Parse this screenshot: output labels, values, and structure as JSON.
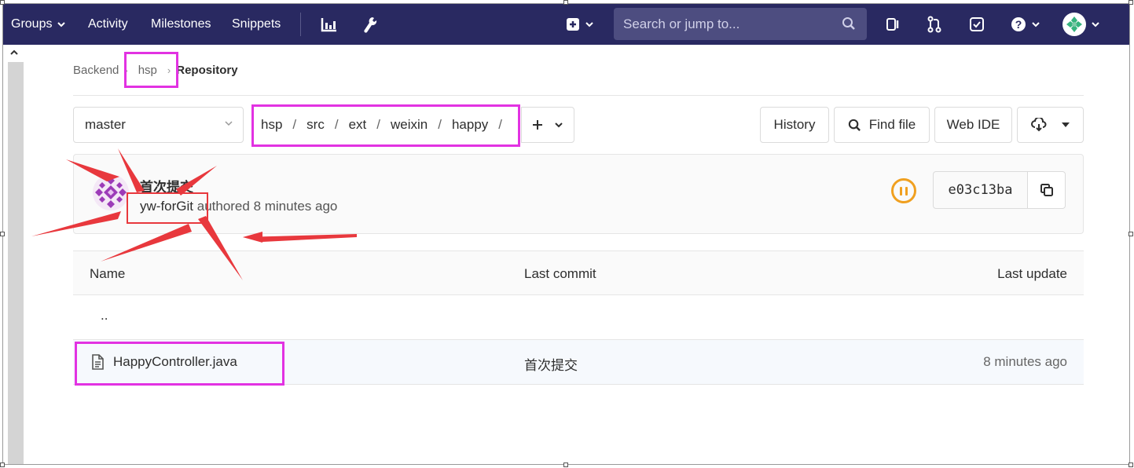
{
  "navbar": {
    "groups": "Groups",
    "activity": "Activity",
    "milestones": "Milestones",
    "snippets": "Snippets",
    "search_placeholder": "Search or jump to..."
  },
  "breadcrumb": {
    "parent": "Backend",
    "project": "hsp",
    "current": "Repository"
  },
  "toolbar": {
    "branch": "master",
    "path_segments": [
      "hsp",
      "src",
      "ext",
      "weixin",
      "happy"
    ],
    "history": "History",
    "find_file": "Find file",
    "web_ide": "Web IDE"
  },
  "commit": {
    "title": "首次提交",
    "author": "yw-forGit",
    "meta": "authored 8 minutes ago",
    "sha": "e03c13ba",
    "pipeline_status": "paused"
  },
  "files": {
    "headers": {
      "name": "Name",
      "last_commit": "Last commit",
      "last_update": "Last update"
    },
    "parent_dir": "..",
    "rows": [
      {
        "name": "HappyController.java",
        "last_commit": "首次提交",
        "last_update": "8 minutes ago"
      }
    ]
  },
  "colors": {
    "navbar": "#292961",
    "highlight": "#e232e2",
    "annotation": "#e8383d",
    "pipeline": "#f0a020"
  }
}
